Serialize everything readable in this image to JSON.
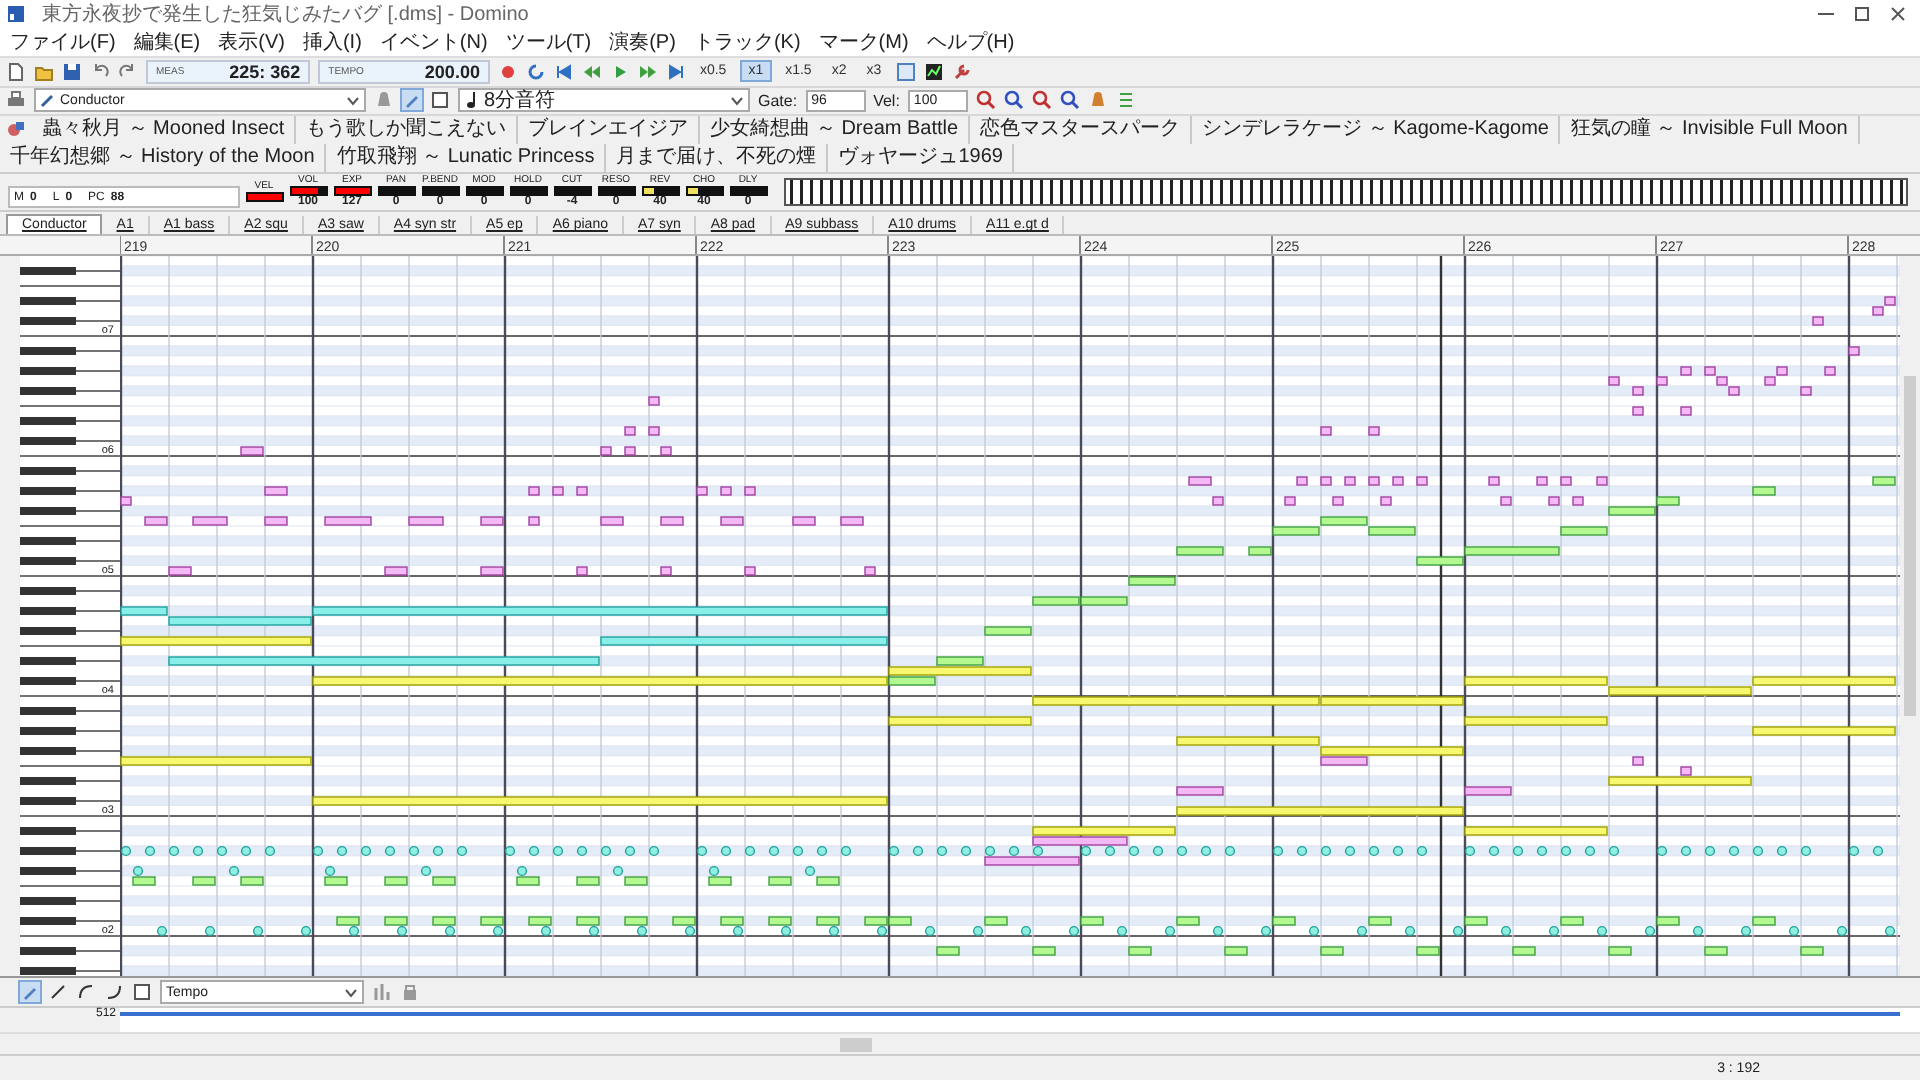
{
  "window": {
    "title": "東方永夜抄で発生した狂気じみたバグ [.dms] - Domino"
  },
  "menu": [
    "ファイル(F)",
    "編集(E)",
    "表示(V)",
    "挿入(I)",
    "イベント(N)",
    "ツール(T)",
    "演奏(P)",
    "トラック(K)",
    "マーク(M)",
    "ヘルプ(H)"
  ],
  "toolbar": {
    "meas_label": "MEAS",
    "meas_value": "225: 362",
    "tempo_label": "TEMPO",
    "tempo_value": "200.00",
    "speeds": [
      {
        "label": "x0.5",
        "selected": false
      },
      {
        "label": "x1",
        "selected": true
      },
      {
        "label": "x1.5",
        "selected": false
      },
      {
        "label": "x2",
        "selected": false
      },
      {
        "label": "x3",
        "selected": false
      }
    ]
  },
  "edit_bar": {
    "track": "Conductor",
    "note_length": "8分音符",
    "gate_label": "Gate:",
    "gate": "96",
    "vel_label": "Vel:",
    "vel": "100"
  },
  "songs": [
    "蟲々秋月 ～ Mooned Insect",
    "もう歌しか聞こえない",
    "ブレインエイジア",
    "少女綺想曲 ～ Dream Battle",
    "恋色マスタースパーク",
    "シンデレラケージ ～ Kagome-Kagome",
    "狂気の瞳 ～ Invisible Full Moon",
    "千年幻想郷 ～ History of the Moon",
    "竹取飛翔 ～ Lunatic Princess",
    "月まで届け、不死の煙",
    "ヴォヤージュ1969"
  ],
  "mixer": {
    "mute_label": "M",
    "mute_value": "0",
    "l_label": "L",
    "l_value": "0",
    "pc_label": "PC",
    "pc_value": "88",
    "controls": [
      {
        "label": "VEL",
        "level": 1,
        "color": "#ff0000"
      },
      {
        "label": "VOL",
        "value": "100",
        "level": 0.79,
        "color": "#ff0000"
      },
      {
        "label": "EXP",
        "value": "127",
        "level": 1,
        "color": "#ff0000"
      },
      {
        "label": "PAN",
        "value": "0"
      },
      {
        "label": "P.BEND",
        "value": "0"
      },
      {
        "label": "MOD",
        "value": "0"
      },
      {
        "label": "HOLD",
        "value": "0"
      },
      {
        "label": "CUT",
        "value": "-4"
      },
      {
        "label": "RESO",
        "value": "0"
      },
      {
        "label": "REV",
        "value": "40",
        "level": 0.31,
        "color": "#f0e060"
      },
      {
        "label": "CHO",
        "value": "40",
        "level": 0.31,
        "color": "#f0e060"
      },
      {
        "label": "DLY",
        "value": "0"
      }
    ]
  },
  "tracks": [
    {
      "label": "Conductor",
      "selected": true
    },
    {
      "label": "A1",
      "selected": false
    },
    {
      "label": "A1 bass",
      "selected": false
    },
    {
      "label": "A2 squ",
      "selected": false
    },
    {
      "label": "A3 saw",
      "selected": false
    },
    {
      "label": "A4 syn str",
      "selected": false
    },
    {
      "label": "A5 ep",
      "selected": false
    },
    {
      "label": "A6 piano",
      "selected": false
    },
    {
      "label": "A7 syn",
      "selected": false
    },
    {
      "label": "A8 pad",
      "selected": false
    },
    {
      "label": "A9 subbass",
      "selected": false
    },
    {
      "label": "A10 drums",
      "selected": false
    },
    {
      "label": "A11 e.gt d",
      "selected": false
    }
  ],
  "ruler": {
    "bars": [
      "219",
      "220",
      "221",
      "222",
      "223",
      "224",
      "225",
      "226",
      "227",
      "228"
    ]
  },
  "piano_roll": {
    "octave_labels": [
      "o7",
      "o6",
      "o5",
      "o4",
      "o3",
      "o2"
    ]
  },
  "bottom_bar": {
    "event_type": "Tempo",
    "scale_value": "512"
  },
  "status_bar": {
    "position": "3 : 192"
  }
}
